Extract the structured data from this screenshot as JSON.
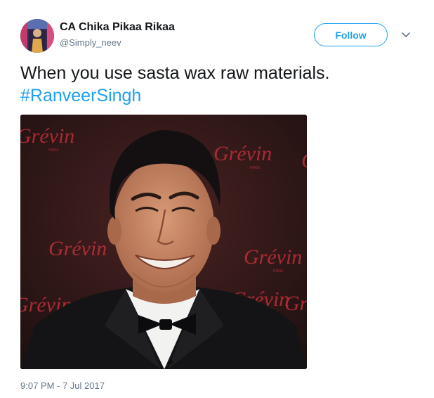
{
  "user": {
    "name": "CA Chika Pikaa Rikaa",
    "handle": "@Simply_neev",
    "avatar_icon": "user-avatar"
  },
  "follow": {
    "label": "Follow"
  },
  "menu": {
    "icon": "chevron-down-icon"
  },
  "tweet": {
    "text": "When you use sasta wax raw materials.",
    "hashtag": "#RanveerSingh"
  },
  "media": {
    "alt": "Wax figure of a smiling man in a tuxedo and bow tie in front of a Grévin backdrop",
    "backdrop_brand": "Grévin",
    "backdrop_sub": "PARIS"
  },
  "meta": {
    "timestamp": "9:07 PM - 7 Jul 2017"
  },
  "colors": {
    "accent": "#1da1f2",
    "text": "#14171a",
    "muted": "#657786"
  }
}
